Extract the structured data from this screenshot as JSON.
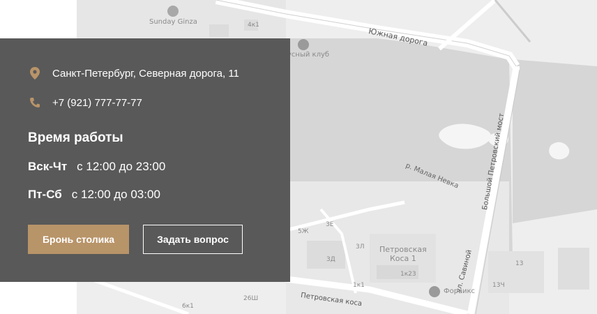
{
  "map": {
    "labels": {
      "sunday_ginza": "Sunday Ginza",
      "bldg_4k1": "4к1",
      "club": "усный клуб",
      "south_road": "Южная дорога",
      "bridge": "Большой Петровский мост",
      "river": "р. Малая Невка",
      "savina_st": "ул. Савиной",
      "petrovskaya_kosa": "Петровская\nКоса 1",
      "bldg_1k23": "1к23",
      "forviks": "Форвикс",
      "petrovskaya_kosa_st": "Петровская коса",
      "bldg_5zh": "5Ж",
      "bldg_3e": "3Е",
      "bldg_3l": "3Л",
      "bldg_3d": "3Д",
      "bldg_1k1": "1к1",
      "bldg_6k1": "6к1",
      "bldg_26sh": "26Ш",
      "bldg_13": "13",
      "bldg_13ch": "13Ч"
    }
  },
  "contact": {
    "address": "Санкт-Петербург, Северная дорога, 11",
    "phone": "+7 (921) 777-77-77"
  },
  "hours": {
    "title": "Время работы",
    "rows": [
      {
        "days": "Вск-Чт",
        "time": "с 12:00 до 23:00"
      },
      {
        "days": "Пт-Сб",
        "time": "с 12:00 до 03:00"
      }
    ]
  },
  "buttons": {
    "book": "Бронь столика",
    "ask": "Задать вопрос"
  },
  "colors": {
    "panel_bg": "#595959",
    "accent": "#b89469",
    "map_bg": "#eeeeee",
    "water": "#d4d4d4"
  }
}
